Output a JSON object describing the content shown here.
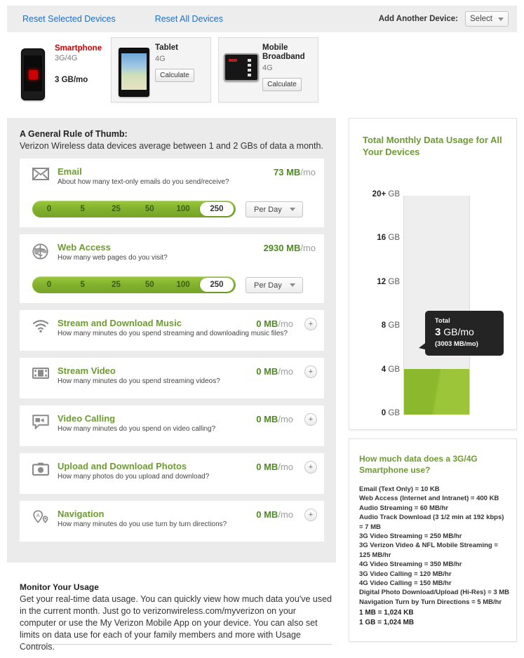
{
  "toolbar": {
    "reset_selected": "Reset Selected Devices",
    "reset_all": "Reset All Devices",
    "add_device_label": "Add Another Device:",
    "select_value": "Select"
  },
  "devices": {
    "selected": {
      "name": "Smartphone",
      "network": "3G/4G",
      "usage": "3 GB/mo",
      "icon": "smartphone-icon"
    },
    "cards": [
      {
        "title": "Tablet",
        "network": "4G",
        "button": "Calculate",
        "icon": "tablet-icon"
      },
      {
        "title": "Mobile Broadband",
        "network": "4G",
        "button": "Calculate",
        "icon": "mobile-broadband-icon"
      }
    ]
  },
  "rule": {
    "title": "A General Rule of Thumb:",
    "subtitle": "Verizon Wireless data devices average between 1 and 2 GBs of data a month."
  },
  "usage_rows": [
    {
      "id": "email",
      "icon": "envelope-icon",
      "title": "Email",
      "question": "About how many text-only emails do you send/receive?",
      "value": "73 MB",
      "unit": "/mo",
      "expanded": true,
      "slider": {
        "ticks": [
          "0",
          "5",
          "25",
          "50",
          "100",
          "250"
        ],
        "selected": "250"
      },
      "period": "Per Day"
    },
    {
      "id": "web-access",
      "icon": "globe-icon",
      "title": "Web Access",
      "question": "How many web pages do you visit?",
      "value": "2930 MB",
      "unit": "/mo",
      "expanded": true,
      "slider": {
        "ticks": [
          "0",
          "5",
          "25",
          "50",
          "100",
          "250"
        ],
        "selected": "250"
      },
      "period": "Per Day"
    },
    {
      "id": "stream-download-music",
      "icon": "wifi-icon",
      "title": "Stream and Download Music",
      "question": "How many minutes do you spend streaming and downloading music files?",
      "value": "0 MB",
      "unit": "/mo",
      "expanded": false,
      "expand_label": "+"
    },
    {
      "id": "stream-video",
      "icon": "film-icon",
      "title": "Stream Video",
      "question": "How many minutes do you spend streaming videos?",
      "value": "0 MB",
      "unit": "/mo",
      "expanded": false,
      "expand_label": "+"
    },
    {
      "id": "video-calling",
      "icon": "video-chat-icon",
      "title": "Video Calling",
      "question": "How many minutes do you spend on video calling?",
      "value": "0 MB",
      "unit": "/mo",
      "expanded": false,
      "expand_label": "+"
    },
    {
      "id": "upload-download-photos",
      "icon": "camera-icon",
      "title": "Upload and Download Photos",
      "question": "How many photos do you upload and download?",
      "value": "0 MB",
      "unit": "/mo",
      "expanded": false,
      "expand_label": "+"
    },
    {
      "id": "navigation",
      "icon": "map-pin-icon",
      "title": "Navigation",
      "question": "How many minutes do you use turn by turn directions?",
      "value": "0 MB",
      "unit": "/mo",
      "expanded": false,
      "expand_label": "+"
    }
  ],
  "monitor": {
    "title": "Monitor Your Usage",
    "body": "Get your real-time data usage. You can quickly view how much data you've used in the current month. Just go to verizonwireless.com/myverizon on your computer or use the My Verizon Mobile App on your device. You can also set limits on data use for each of your family members and more with Usage Controls."
  },
  "chart_card": {
    "title": "Total Monthly Data Usage for All Your Devices",
    "tooltip": {
      "label": "Total",
      "value": "3",
      "unit": "GB/mo",
      "sub": "(3003 MB/mo)"
    }
  },
  "chart_data": {
    "type": "bar",
    "title": "Total Monthly Data Usage for All Your Devices",
    "categories": [
      "Total"
    ],
    "values": [
      3
    ],
    "value_label": "3 GB/mo",
    "value_detail": "3003 MB/mo",
    "ylabel": "GB",
    "ylim": [
      0,
      20
    ],
    "ytick_values": [
      0,
      4,
      8,
      12,
      16,
      20
    ],
    "ytick_labels": [
      "0 GB",
      "4 GB",
      "8 GB",
      "12 GB",
      "16 GB",
      "20+ GB"
    ],
    "grid": false,
    "legend": false,
    "bar_color": "#8cb82e",
    "track_color": "#eeeeee"
  },
  "info_card": {
    "title": "How much data does a 3G/4G Smartphone use?",
    "items": [
      "Email (Text Only) = 10 KB",
      "Web Access (Internet and Intranet) = 400 KB",
      "Audio Streaming = 60 MB/hr",
      "Audio Track Download (3 1/2 min at 192 kbps) = 7 MB",
      "3G Video Streaming = 250 MB/hr",
      "3G Verizon Video & NFL Mobile Streaming = 125 MB/hr",
      "4G Video Streaming = 350 MB/hr",
      "3G Video Calling = 120 MB/hr",
      "4G Video Calling = 150 MB/hr",
      "Digital Photo Download/Upload (Hi-Res) = 3 MB",
      "Navigation Turn by Turn Directions = 5 MB/hr"
    ],
    "footnotes": [
      "1 MB = 1,024 KB",
      "1 GB = 1,024 MB"
    ]
  },
  "colors": {
    "green": "#6d9a33",
    "value_green": "#4c8b1f",
    "bar_green": "#8cb82e",
    "link_blue": "#1d6fc4",
    "red": "#cc0000",
    "panel_bg": "#ebebeb"
  }
}
